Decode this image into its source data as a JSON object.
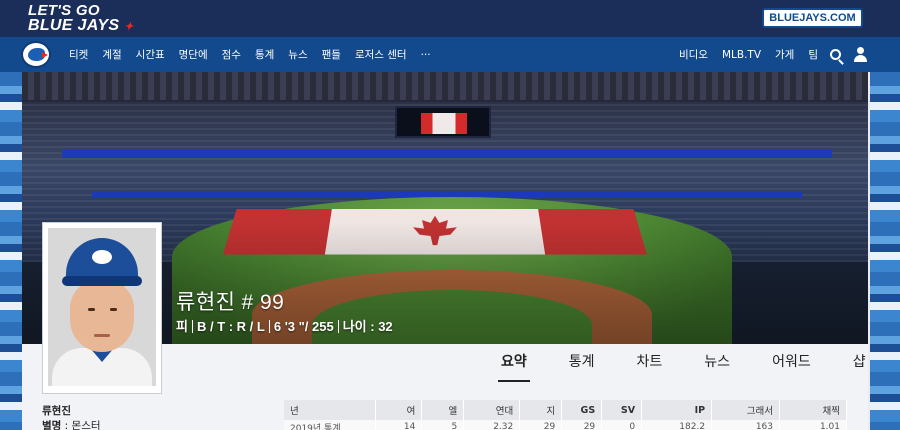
{
  "brand": {
    "slogan_line1": "LET'S GO",
    "slogan_line2": "BLUE JAYS",
    "site_button": "BLUEJAYS.COM"
  },
  "nav": {
    "items": [
      "티켓",
      "계절",
      "시간표",
      "명단에",
      "점수",
      "통계",
      "뉴스",
      "팬들",
      "로저스 센터",
      "···"
    ],
    "right_items": [
      "비디오",
      "MLB.TV",
      "가게",
      "팀"
    ],
    "icons": [
      "search-icon",
      "user-icon"
    ]
  },
  "player": {
    "name": "류현진",
    "number": "# 99",
    "meta": [
      "피",
      "B / T : R / L",
      "6 '3 \"/ 255",
      "나이 : 32"
    ]
  },
  "tabs": [
    "요약",
    "통계",
    "차트",
    "뉴스",
    "어워드",
    "샵"
  ],
  "active_tab": "요약",
  "info": {
    "name": "류현진",
    "nickname_label": "별명",
    "nickname_value": "몬스터"
  },
  "stats_table": {
    "headers": [
      "년",
      "여",
      "엘",
      "연대",
      "지",
      "GS",
      "SV",
      "IP",
      "그래서",
      "채찍"
    ],
    "bold_headers": [
      "GS",
      "SV",
      "IP"
    ],
    "partial_row": [
      "2019년 통계",
      "14",
      "5",
      "2.32",
      "29",
      "29",
      "0",
      "182.2",
      "163",
      "1.01"
    ]
  },
  "colors": {
    "brand_dark": "#1b2e5a",
    "nav_blue": "#134a8e",
    "flag_red": "#c23232"
  }
}
